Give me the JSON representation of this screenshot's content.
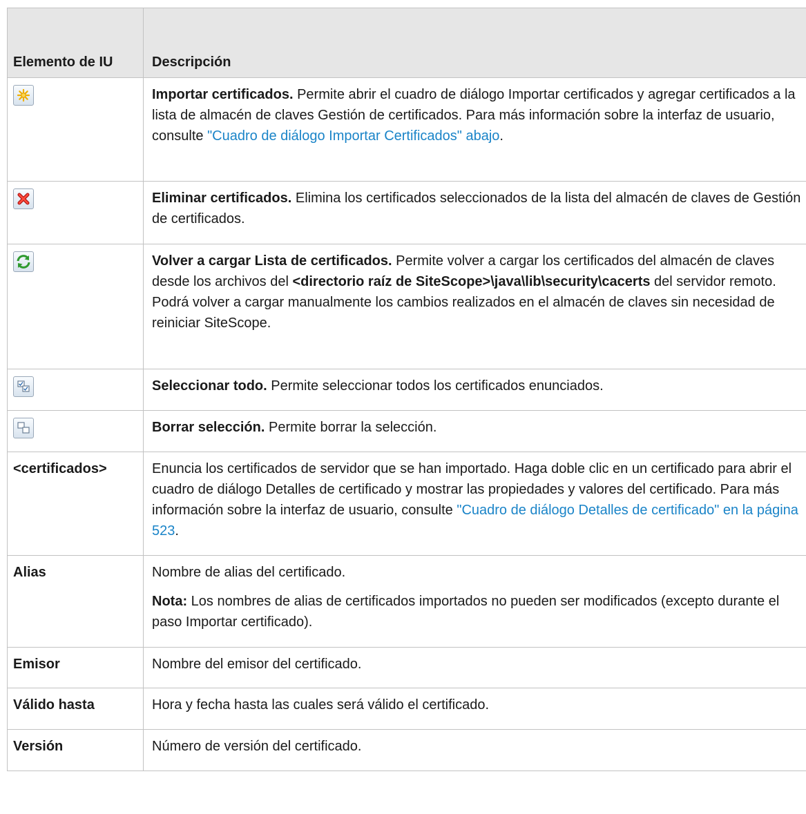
{
  "header": {
    "col1": "Elemento de IU",
    "col2": "Descripción"
  },
  "rows": {
    "import": {
      "icon": "import-certificates-icon",
      "title": "Importar certificados.",
      "text": " Permite abrir el cuadro de diálogo Importar certificados y agregar certificados a la lista de almacén de claves Gestión de certificados. Para más información sobre la interfaz de usuario, consulte ",
      "link": "\"Cuadro de diálogo Importar Certificados\" abajo",
      "end": "."
    },
    "delete": {
      "icon": "delete-certificates-icon",
      "title": "Eliminar certificados.",
      "text": " Elimina los certificados seleccionados de la lista del almacén de claves de Gestión de certificados."
    },
    "reload": {
      "icon": "reload-list-icon",
      "title": "Volver a cargar Lista de certificados.",
      "text1": " Permite volver a cargar los certificados del almacén de claves desde los archivos del ",
      "path": "<directorio raíz de SiteScope>\\java\\lib\\security\\cacerts",
      "text2": " del servidor remoto. Podrá volver a cargar manualmente los cambios realizados en el almacén de claves sin necesidad de reiniciar SiteScope."
    },
    "select_all": {
      "icon": "select-all-icon",
      "title": "Seleccionar todo.",
      "text": " Permite seleccionar todos los certificados enunciados."
    },
    "clear": {
      "icon": "clear-selection-icon",
      "title": "Borrar selección.",
      "text": " Permite borrar la selección."
    },
    "certs": {
      "label": "<certificados>",
      "text": "Enuncia los certificados de servidor que se han importado. Haga doble clic en un certificado para abrir el cuadro de diálogo Detalles de certificado y mostrar las propiedades y valores del certificado. Para más información sobre la interfaz de usuario, consulte ",
      "link": "\"Cuadro de diálogo Detalles de certificado\" en la página 523",
      "end": "."
    },
    "alias": {
      "label": "Alias",
      "text": "Nombre de alias del certificado.",
      "note_label": "Nota:",
      "note_text": " Los nombres de alias de certificados importados no pueden ser modificados (excepto durante el paso Importar certificado)."
    },
    "issuer": {
      "label": "Emisor",
      "text": "Nombre del emisor del certificado."
    },
    "valid": {
      "label": "Válido hasta",
      "text": "Hora y fecha hasta las cuales será válido el certificado."
    },
    "version": {
      "label": "Versión",
      "text": "Número de versión del certificado."
    }
  },
  "colors": {
    "header_bg": "#e6e6e6",
    "border": "#c2c2c2",
    "link": "#1a84c8"
  }
}
